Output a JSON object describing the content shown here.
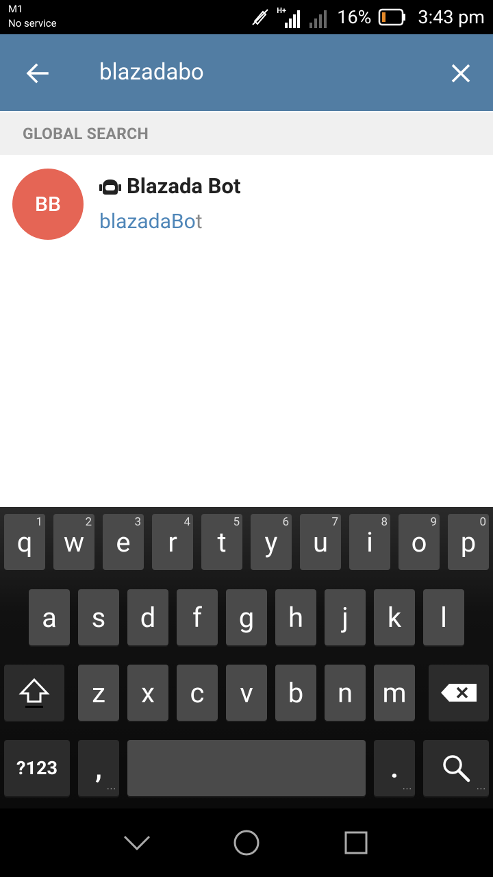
{
  "status_bar": {
    "carrier": "M1",
    "service": "No service",
    "network_type": "H+",
    "battery_percent": "16%",
    "time": "3:43 pm"
  },
  "toolbar": {
    "back_icon": "arrow-back-icon",
    "search_value": "blazadabo",
    "clear_icon": "close-icon",
    "color": "#527da3"
  },
  "section": {
    "title": "GLOBAL SEARCH"
  },
  "results": [
    {
      "initials": "BB",
      "avatar_color": "#e56555",
      "name": "Blazada Bot",
      "username_match": "blazadaBo",
      "username_rest": "t",
      "type_icon": "bot-icon"
    }
  ],
  "keyboard": {
    "row1": [
      {
        "label": "q",
        "hint": "1"
      },
      {
        "label": "w",
        "hint": "2"
      },
      {
        "label": "e",
        "hint": "3"
      },
      {
        "label": "r",
        "hint": "4"
      },
      {
        "label": "t",
        "hint": "5"
      },
      {
        "label": "y",
        "hint": "6"
      },
      {
        "label": "u",
        "hint": "7"
      },
      {
        "label": "i",
        "hint": "8"
      },
      {
        "label": "o",
        "hint": "9"
      },
      {
        "label": "p",
        "hint": "0"
      }
    ],
    "row2": [
      "a",
      "s",
      "d",
      "f",
      "g",
      "h",
      "j",
      "k",
      "l"
    ],
    "row3": [
      "z",
      "x",
      "c",
      "v",
      "b",
      "n",
      "m"
    ],
    "symbols_label": "?123",
    "comma_label": ",",
    "period_label": ".",
    "shift_icon": "shift-icon",
    "backspace_icon": "backspace-icon",
    "search_icon": "search-icon"
  },
  "nav_bar": {
    "back_icon": "nav-back-icon",
    "home_icon": "nav-home-icon",
    "recents_icon": "nav-recents-icon"
  }
}
